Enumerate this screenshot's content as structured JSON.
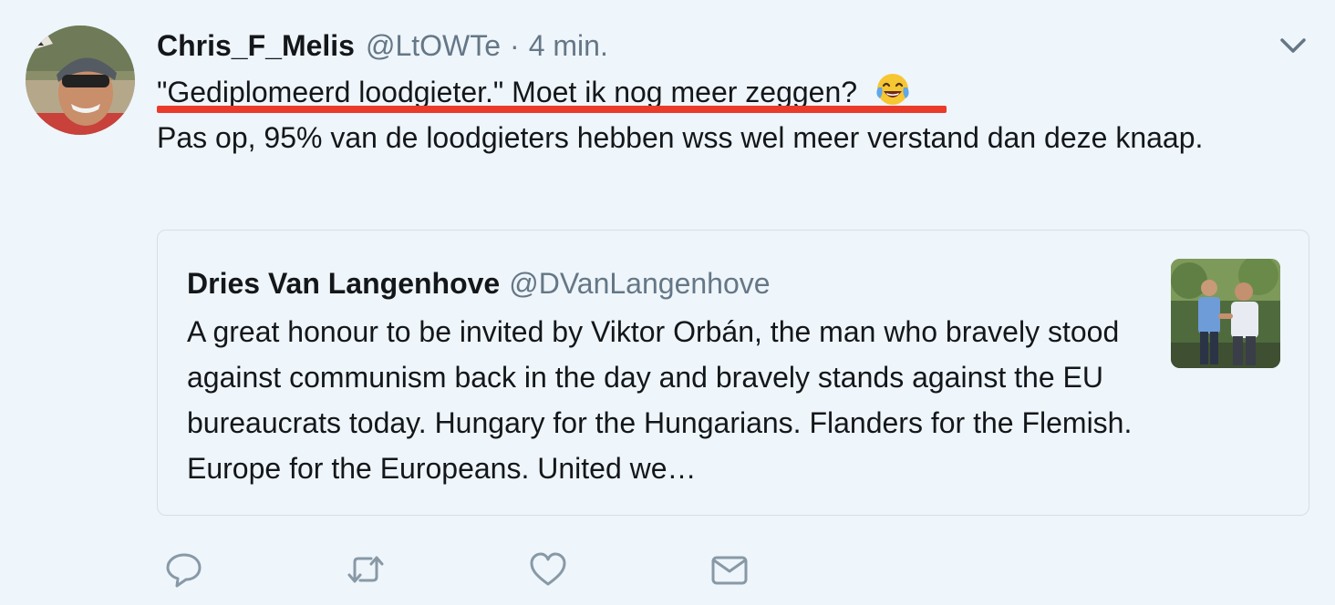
{
  "tweet": {
    "display_name": "Chris_F_Melis",
    "handle": "@LtOWTe",
    "separator": "·",
    "time": "4 min.",
    "text_line1": "\"Gediplomeerd loodgieter.\" Moet ik nog meer zeggen?",
    "emoji": "face-with-tears-of-joy",
    "text_rest": "Pas op, 95% van de loodgieters hebben wss wel meer verstand dan deze knaap.",
    "avatar_icon": "cyclist-avatar",
    "menu_icon": "chevron-down-icon"
  },
  "quoted_tweet": {
    "display_name": "Dries Van Langenhove",
    "handle": "@DVanLangenhove",
    "text": "A great honour to be invited by Viktor Orbán, the man who bravely stood against communism back in the day and bravely stands against the EU bureaucrats today. Hungary for the Hungarians. Flanders for the Flemish. Europe for the Europeans. United we…",
    "thumbnail_icon": "two-men-handshake-photo"
  },
  "actions": [
    {
      "name": "reply-icon"
    },
    {
      "name": "retweet-icon"
    },
    {
      "name": "like-icon"
    },
    {
      "name": "direct-message-icon"
    }
  ],
  "colors": {
    "background": "#eef5fb",
    "text": "#14171a",
    "secondary": "#657786",
    "highlight_underline": "#ea3b2a"
  }
}
